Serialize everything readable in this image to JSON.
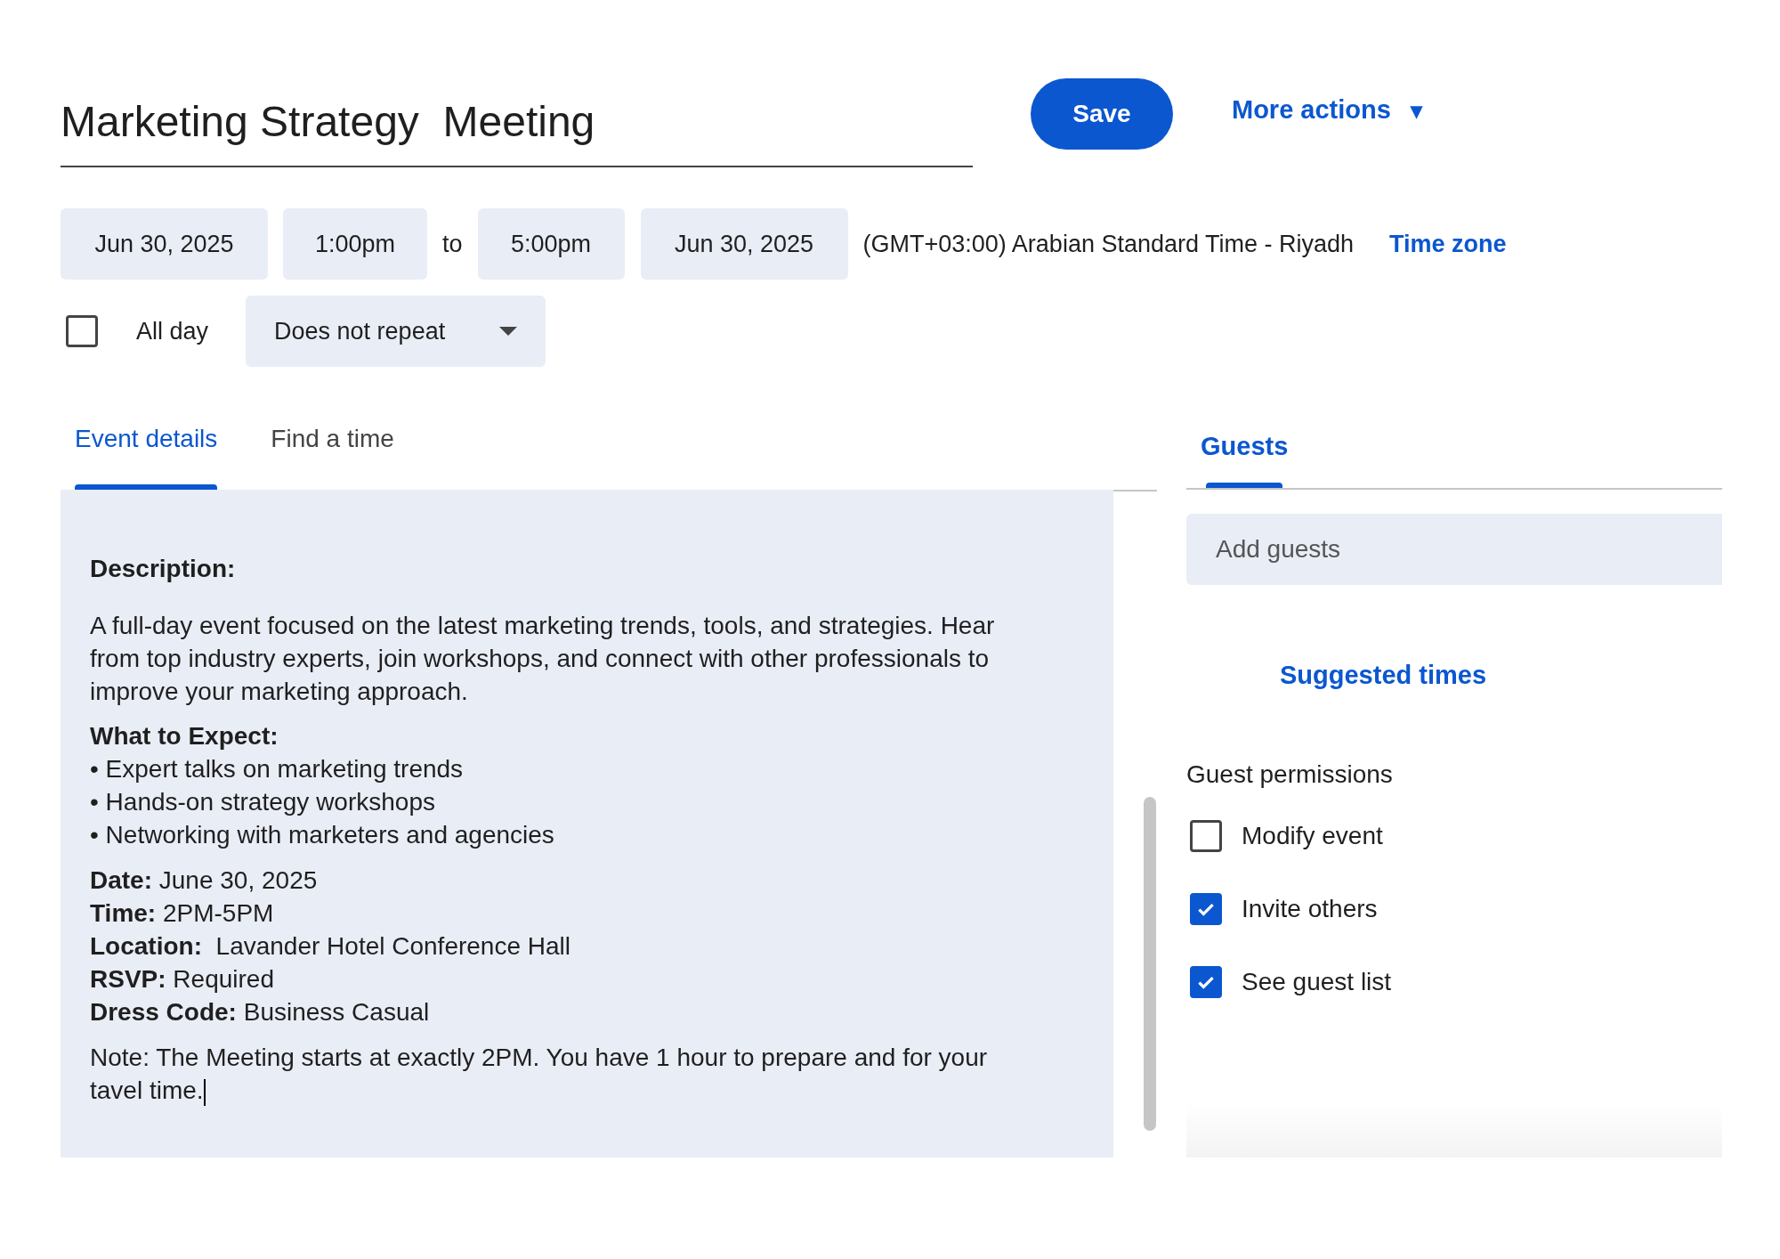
{
  "title": "Marketing Strategy  Meeting",
  "save_button": "Save",
  "more_actions": {
    "label": "More actions",
    "caret": "▾"
  },
  "schedule": {
    "start_date": "Jun 30, 2025",
    "start_time": "1:00pm",
    "separator": "to",
    "end_time": "5:00pm",
    "end_date": "Jun 30, 2025",
    "time_zone_text": "(GMT+03:00) Arabian Standard Time - Riyadh",
    "time_zone_link": "Time zone"
  },
  "all_day": {
    "label": "All day",
    "checked": false
  },
  "repeat": {
    "value": "Does not repeat"
  },
  "tabs": [
    {
      "label": "Event details",
      "selected": true
    },
    {
      "label": "Find a time",
      "selected": false
    }
  ],
  "description": {
    "heading": "Description:",
    "paragraph": "A full-day event focused on the latest marketing trends, tools, and strategies. Hear from top industry experts, join workshops, and connect with other professionals to improve your marketing approach.",
    "expect_heading": "What to Expect:",
    "bullets": [
      "• Expert talks on marketing trends",
      "• Hands-on strategy workshops",
      "• Networking with marketers and agencies"
    ],
    "facts": [
      "**Date:** June 30, 2025",
      "**Time:** 2PM-5PM",
      "**Location:**  Lavander Hotel Conference Hall",
      "**RSVP:** Required",
      "**Dress Code:** Business Casual"
    ],
    "note": "Note: The Meeting starts at exactly 2PM. You have 1 hour to prepare and for your tavel time."
  },
  "guests_panel": {
    "tab": {
      "label": "Guests",
      "selected": true
    },
    "add_guests": {
      "placeholder": "Add guests"
    },
    "suggested_times": "Suggested times",
    "permissions_heading": "Guest permissions",
    "permissions": [
      {
        "label": "Modify event",
        "checked": false
      },
      {
        "label": "Invite others",
        "checked": true
      },
      {
        "label": "See guest list",
        "checked": true
      }
    ]
  }
}
